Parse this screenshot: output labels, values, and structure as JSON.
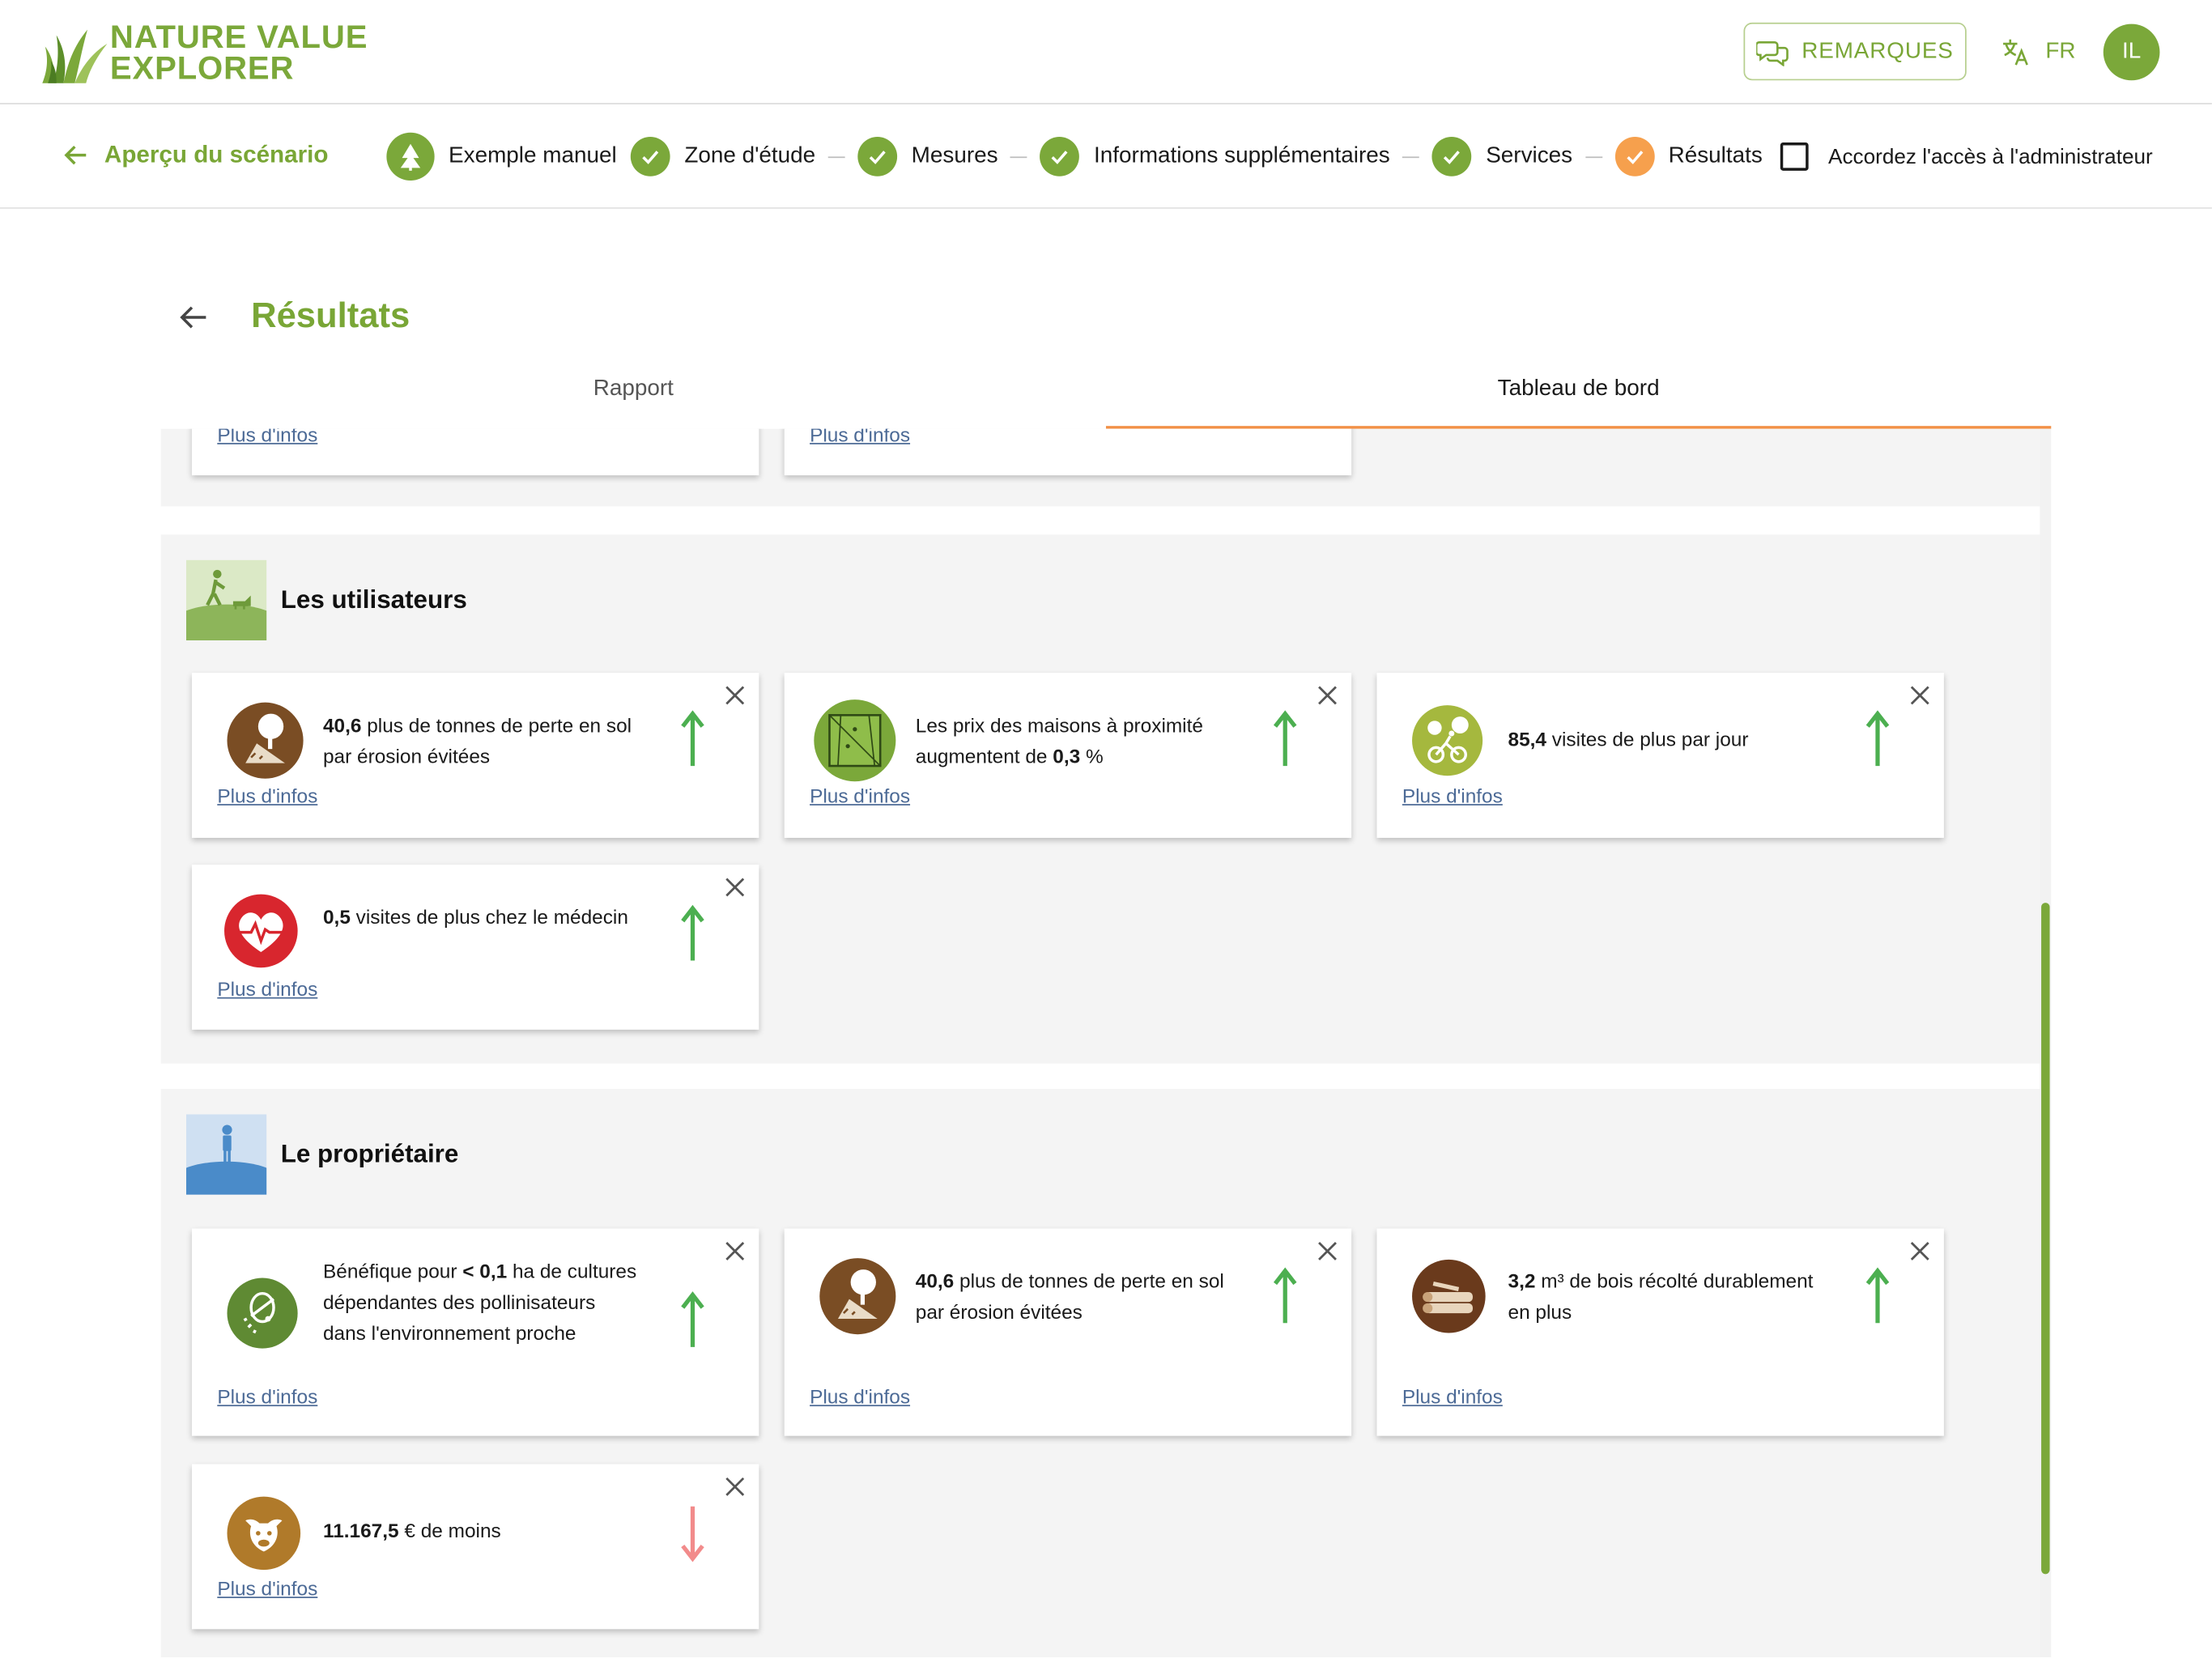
{
  "header": {
    "logo_line1": "NATURE VALUE",
    "logo_line2": "EXPLORER",
    "remarks_label": "REMARQUES",
    "language": "FR",
    "avatar_initials": "IL"
  },
  "stepper": {
    "back_label": "Aperçu du scénario",
    "steps": [
      {
        "label": "Exemple manuel",
        "state": "scenario"
      },
      {
        "label": "Zone d'étude",
        "state": "done"
      },
      {
        "label": "Mesures",
        "state": "done"
      },
      {
        "label": "Informations supplémentaires",
        "state": "done"
      },
      {
        "label": "Services",
        "state": "done"
      },
      {
        "label": "Résultats",
        "state": "current"
      }
    ],
    "admin_access_label": "Accordez l'accès à l'administrateur"
  },
  "page": {
    "title": "Résultats",
    "tabs": [
      "Rapport",
      "Tableau de bord"
    ],
    "active_tab": "Tableau de bord"
  },
  "more_info_label": "Plus d'infos",
  "sections": [
    {
      "title": "Les utilisateurs",
      "icon": "hiker-dog-icon",
      "cards": [
        {
          "icon": "erosion-tree-icon",
          "pre": "",
          "value": "40,6",
          "post": " plus de tonnes de perte en sol par érosion évitées",
          "trend": "up"
        },
        {
          "icon": "house-price-icon",
          "pre": "Les prix des maisons à proximité augmentent de ",
          "value": "0,3",
          "post": " %",
          "trend": "up"
        },
        {
          "icon": "cyclist-trees-icon",
          "pre": "",
          "value": "85,4",
          "post": " visites de plus par jour",
          "trend": "up"
        },
        {
          "icon": "heart-pulse-icon",
          "pre": "",
          "value": "0,5",
          "post": " visites de plus chez le médecin",
          "trend": "up"
        }
      ]
    },
    {
      "title": "Le propriétaire",
      "icon": "landowner-icon",
      "cards": [
        {
          "icon": "pollinator-icon",
          "pre": "Bénéfique pour ",
          "value": "< 0,1",
          "post": " ha de cultures dépendantes des pollinisateurs dans l'environnement proche",
          "trend": "up"
        },
        {
          "icon": "erosion-tree-icon",
          "pre": "",
          "value": "40,6",
          "post": " plus de tonnes de perte en sol par érosion évitées",
          "trend": "up"
        },
        {
          "icon": "timber-logs-icon",
          "pre": "",
          "value": "3,2",
          "post": " m³ de bois récolté durablement en plus",
          "trend": "up"
        },
        {
          "icon": "livestock-cow-icon",
          "pre": "",
          "value": "11.167,5",
          "post": " € de moins",
          "trend": "down"
        }
      ]
    }
  ],
  "colors": {
    "brand_green": "#7ba83a",
    "accent_orange": "#f29046",
    "trend_up": "#4caf50",
    "trend_down": "#f28b8b",
    "link": "#4c6a96"
  }
}
